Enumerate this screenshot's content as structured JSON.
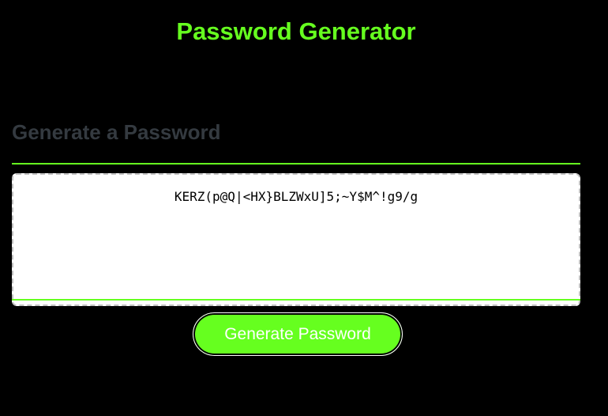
{
  "header": {
    "title": "Password Generator"
  },
  "card": {
    "heading": "Generate a Password",
    "password_value": "KERZ(p@Q|<HX}BLZWxU]5;~Y$M^!g9/g"
  },
  "actions": {
    "generate_label": "Generate Password"
  },
  "colors": {
    "accent": "#66ff1f",
    "background": "#000000",
    "heading_muted": "#343a40",
    "textarea_bg": "#ffffff"
  }
}
